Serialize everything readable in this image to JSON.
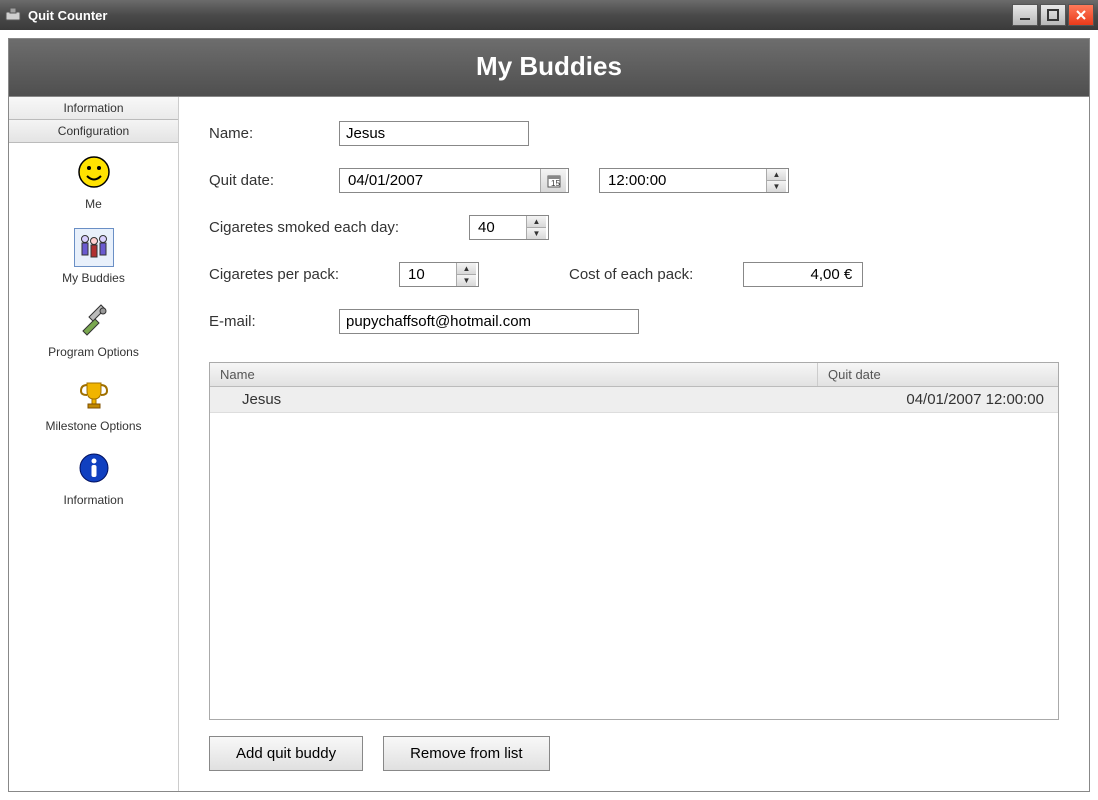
{
  "window": {
    "title": "Quit Counter"
  },
  "header": {
    "title": "My Buddies"
  },
  "sidebar": {
    "tabs": [
      {
        "label": "Information"
      },
      {
        "label": "Configuration"
      }
    ],
    "items": [
      {
        "label": "Me",
        "icon": "smiley-icon"
      },
      {
        "label": "My Buddies",
        "icon": "people-icon",
        "selected": true
      },
      {
        "label": "Program Options",
        "icon": "tools-icon"
      },
      {
        "label": "Milestone Options",
        "icon": "trophy-icon"
      },
      {
        "label": "Information",
        "icon": "info-icon"
      }
    ]
  },
  "form": {
    "name_label": "Name:",
    "name_value": "Jesus",
    "quitdate_label": "Quit date:",
    "quitdate_value": "04/01/2007",
    "quittime_value": "12:00:00",
    "cigs_day_label": "Cigaretes smoked each day:",
    "cigs_day_value": "40",
    "cigs_pack_label": "Cigaretes per pack:",
    "cigs_pack_value": "10",
    "cost_label": "Cost of each pack:",
    "cost_value": "4,00 €",
    "email_label": "E-mail:",
    "email_value": "pupychaffsoft@hotmail.com"
  },
  "list": {
    "columns": {
      "name": "Name",
      "date": "Quit date"
    },
    "rows": [
      {
        "name": "Jesus",
        "date": "04/01/2007 12:00:00"
      }
    ]
  },
  "buttons": {
    "add": "Add quit buddy",
    "remove": "Remove from list"
  }
}
